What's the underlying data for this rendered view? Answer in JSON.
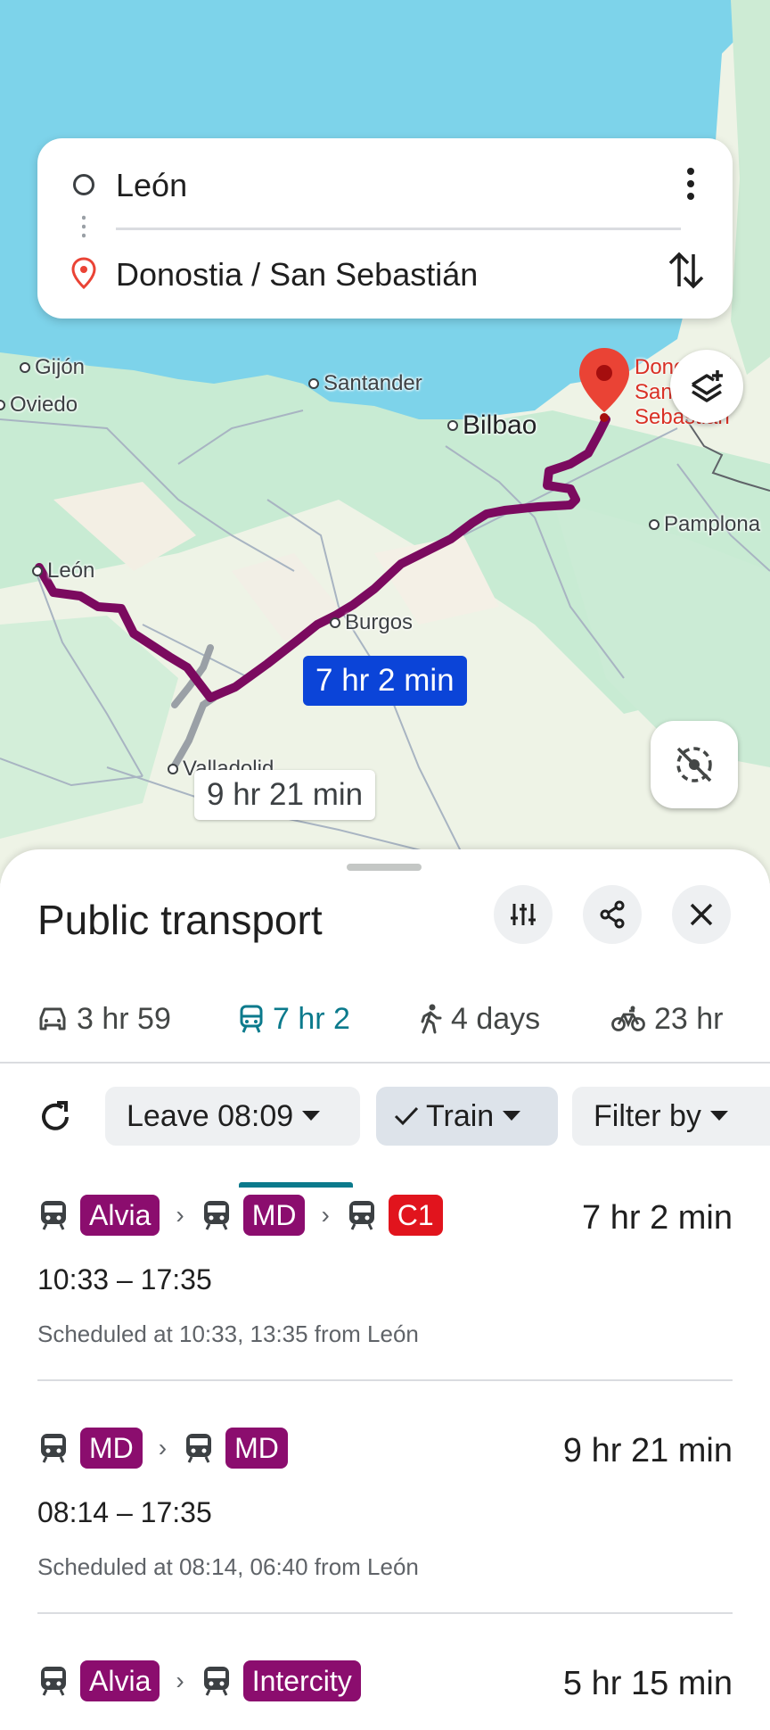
{
  "search": {
    "origin": "León",
    "destination": "Donostia / San Sebastián"
  },
  "map": {
    "cities": {
      "gijon": "Gijón",
      "oviedo": "Oviedo",
      "santander": "Santander",
      "bilbao": "Bilbao",
      "pamplona": "Pamplona",
      "leon": "León",
      "burgos": "Burgos",
      "valladolid": "Valladolid",
      "donostia_line1": "Donostia /",
      "donostia_line2": "San Sebastián"
    },
    "route_primary_label": "7 hr 2 min",
    "route_alternative_label": "9 hr 21 min",
    "route_color": "#7b0a5f",
    "route_alt_color": "#9aa0a6"
  },
  "sheet": {
    "title": "Public transport",
    "tabs": [
      {
        "icon": "car-icon",
        "label": "3 hr 59"
      },
      {
        "icon": "train-icon",
        "label": "7 hr 2"
      },
      {
        "icon": "walk-icon",
        "label": "4 days"
      },
      {
        "icon": "bike-icon",
        "label": "23 hr"
      }
    ],
    "active_tab": 1,
    "accent": "#0b7a8c",
    "filters": {
      "leave": "Leave 08:09",
      "mode": "Train",
      "filter_by": "Filter by"
    }
  },
  "routes": [
    {
      "legs": [
        {
          "label": "Alvia",
          "color": "purple"
        },
        {
          "label": "MD",
          "color": "purple"
        },
        {
          "label": "C1",
          "color": "red"
        }
      ],
      "duration": "7 hr 2 min",
      "times": "10:33 – 17:35",
      "scheduled": "Scheduled at 10:33, 13:35 from León"
    },
    {
      "legs": [
        {
          "label": "MD",
          "color": "purple"
        },
        {
          "label": "MD",
          "color": "purple"
        }
      ],
      "duration": "9 hr 21 min",
      "times": "08:14 – 17:35",
      "scheduled": "Scheduled at 08:14, 06:40 from León"
    },
    {
      "legs": [
        {
          "label": "Alvia",
          "color": "purple"
        },
        {
          "label": "Intercity",
          "color": "purple"
        }
      ],
      "duration": "5 hr 15 min"
    }
  ]
}
